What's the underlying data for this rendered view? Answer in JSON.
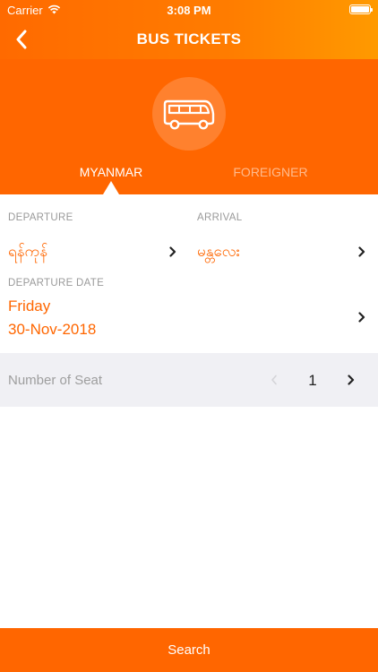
{
  "status_bar": {
    "carrier": "Carrier",
    "time": "3:08 PM"
  },
  "nav": {
    "title": "BUS TICKETS"
  },
  "tabs": [
    {
      "label": "MYANMAR",
      "active": true
    },
    {
      "label": "FOREIGNER",
      "active": false
    }
  ],
  "form": {
    "departure_label": "DEPARTURE",
    "departure_value": "ရန်ကုန်",
    "arrival_label": "ARRIVAL",
    "arrival_value": "မန္တလေး",
    "date_label": "DEPARTURE DATE",
    "date_day": "Friday",
    "date_value": "30-Nov-2018"
  },
  "seat": {
    "label": "Number of Seat",
    "count": "1"
  },
  "search_button": "Search",
  "colors": {
    "accent": "#ff6600",
    "header_gradient_end": "#ff9a00",
    "label_gray": "#9a9a9a",
    "seat_row_bg": "#f0f0f4"
  },
  "icons": [
    "back-chevron-icon",
    "wifi-icon",
    "battery-icon",
    "bus-icon",
    "chevron-right-icon",
    "chevron-left-icon"
  ]
}
